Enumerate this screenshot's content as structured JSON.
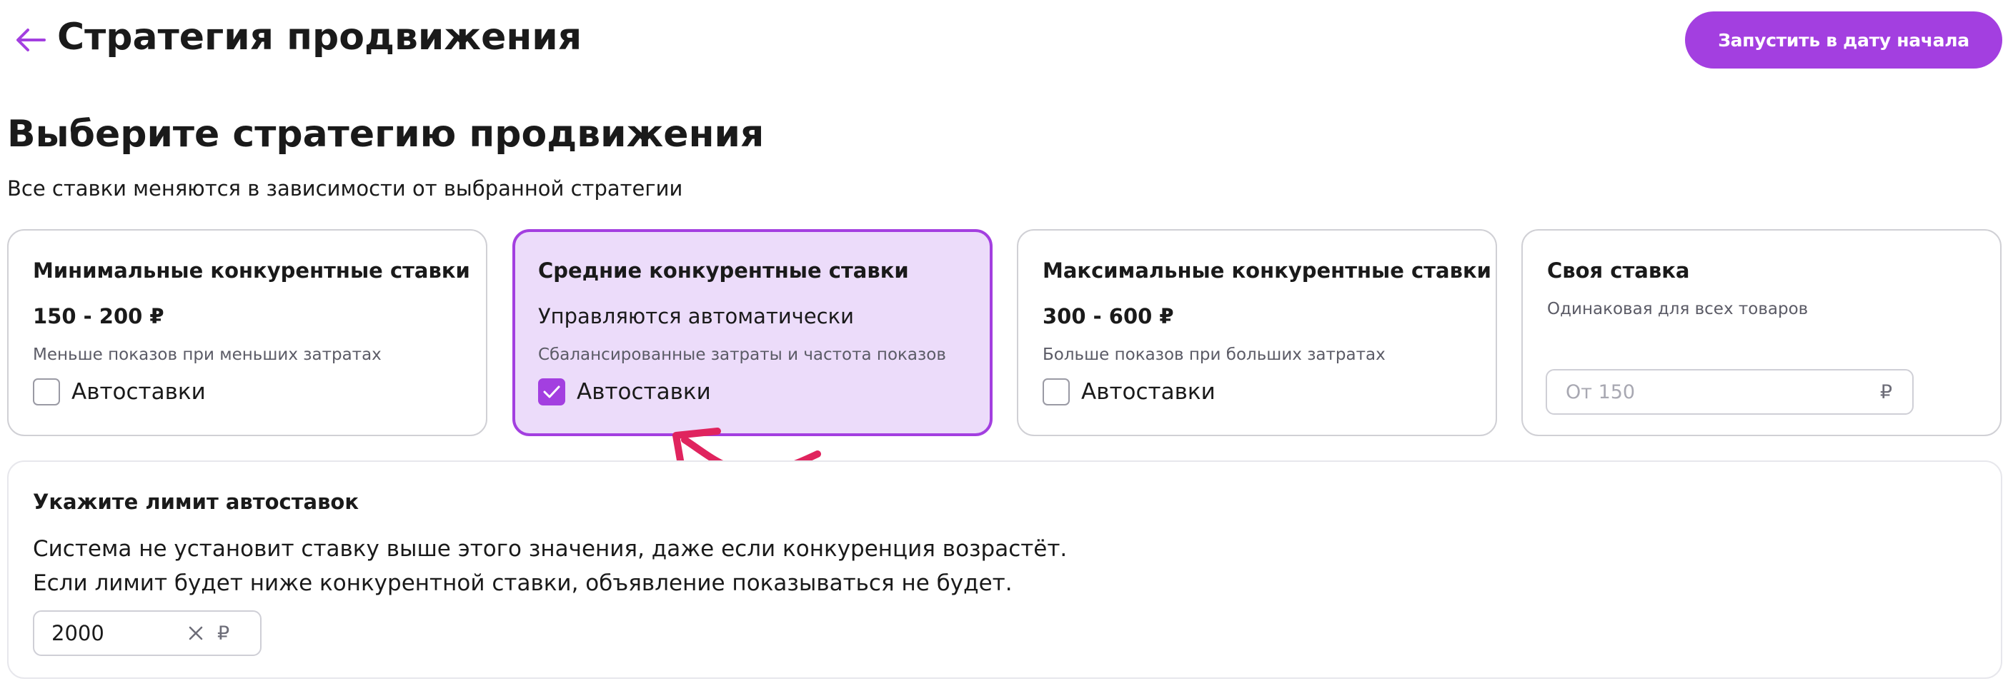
{
  "header": {
    "title": "Стратегия продвижения",
    "launch_button_label": "Запустить в дату начала"
  },
  "section": {
    "title": "Выберите стратегию продвижения",
    "subtitle": "Все ставки меняются в зависимости от выбранной стратегии"
  },
  "strategies": [
    {
      "title": "Минимальные конкурентные ставки",
      "price": "150 - 200 ₽",
      "description": "Меньше показов при меньших затратах",
      "autobid_label": "Автоставки",
      "autobid_checked": false,
      "selected": false
    },
    {
      "title": "Средние конкурентные ставки",
      "price": "Управляются автоматически",
      "description": "Сбалансированные затраты и частота показов",
      "autobid_label": "Автоставки",
      "autobid_checked": true,
      "selected": true
    },
    {
      "title": "Максимальные конкурентные ставки",
      "price": "300 - 600 ₽",
      "description": "Больше показов при больших затратах",
      "autobid_label": "Автоставки",
      "autobid_checked": false,
      "selected": false
    },
    {
      "title": "Своя ставка",
      "description": "Одинаковая для всех товаров",
      "input_placeholder": "От 150",
      "input_value": "",
      "currency": "₽",
      "selected": false
    }
  ],
  "limit": {
    "title": "Укажите лимит автоставок",
    "text_line_1": "Система не установит ставку выше этого значения, даже если конкуренция возрастёт.",
    "text_line_2": "Если лимит будет ниже конкурентной ставки, объявление показываться не будет.",
    "input_value": "2000",
    "currency": "₽"
  },
  "icons": {
    "back": "arrow-left-icon",
    "check": "check-icon",
    "clear": "close-icon",
    "annotation": "curved-arrow-icon"
  },
  "colors": {
    "accent": "#a33fe0",
    "selected_card_bg": "#ecdcfa",
    "annotation": "#e0245e"
  }
}
